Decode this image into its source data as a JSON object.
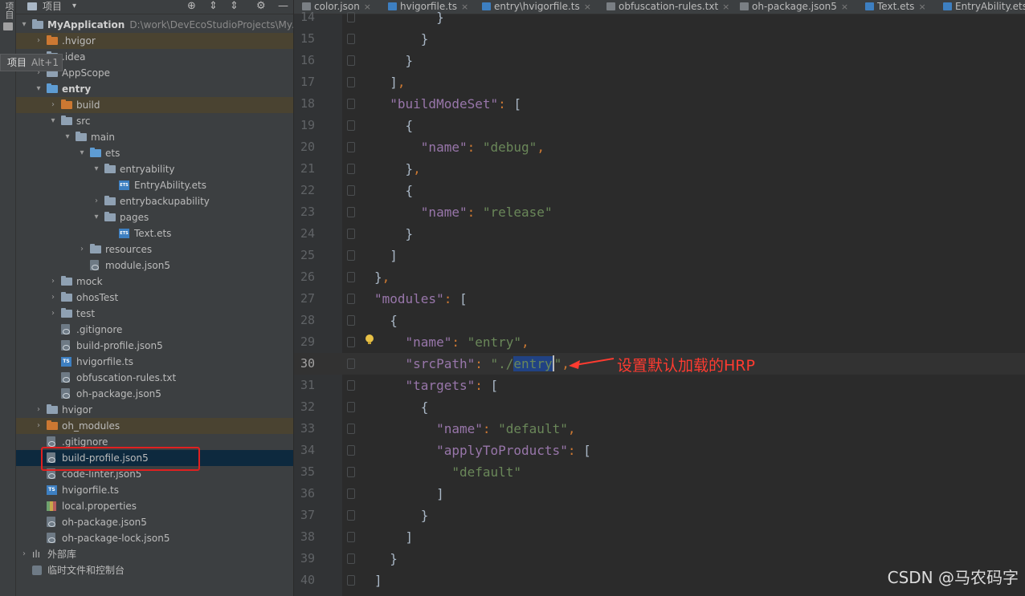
{
  "toolstrip": {
    "label": "项目"
  },
  "panel": {
    "title": "项目",
    "caret": "▾",
    "locate_icon": "⊕",
    "expand_icon": "⇕",
    "collapse_icon": "⇕",
    "settings_icon": "⚙",
    "minimize_icon": "—"
  },
  "tooltip": {
    "text": "项目",
    "shortcut": "Alt+1"
  },
  "tree": [
    {
      "label": "MyApplication",
      "path": "D:\\work\\DevEcoStudioProjects\\MyA",
      "arrow": "▾",
      "icon": "folder"
    },
    {
      "label": ".hvigor",
      "arrow": "›",
      "icon": "folder orange"
    },
    {
      "label": ".idea",
      "arrow": "›",
      "icon": "folder"
    },
    {
      "label": "AppScope",
      "arrow": "›",
      "icon": "folder"
    },
    {
      "label": "entry",
      "arrow": "▾",
      "icon": "folder blue"
    },
    {
      "label": "build",
      "arrow": "›",
      "icon": "folder orange"
    },
    {
      "label": "src",
      "arrow": "▾",
      "icon": "folder"
    },
    {
      "label": "main",
      "arrow": "▾",
      "icon": "folder"
    },
    {
      "label": "ets",
      "arrow": "▾",
      "icon": "folder blue"
    },
    {
      "label": "entryability",
      "arrow": "▾",
      "icon": "folder"
    },
    {
      "label": "EntryAbility.ets",
      "arrow": "",
      "icon": "ets"
    },
    {
      "label": "entrybackupability",
      "arrow": "›",
      "icon": "folder"
    },
    {
      "label": "pages",
      "arrow": "▾",
      "icon": "folder"
    },
    {
      "label": "Text.ets",
      "arrow": "",
      "icon": "ets"
    },
    {
      "label": "resources",
      "arrow": "›",
      "icon": "folder"
    },
    {
      "label": "module.json5",
      "arrow": "",
      "icon": "file"
    },
    {
      "label": "mock",
      "arrow": "›",
      "icon": "folder"
    },
    {
      "label": "ohosTest",
      "arrow": "›",
      "icon": "folder"
    },
    {
      "label": "test",
      "arrow": "›",
      "icon": "folder"
    },
    {
      "label": ".gitignore",
      "arrow": "",
      "icon": "file"
    },
    {
      "label": "build-profile.json5",
      "arrow": "",
      "icon": "file"
    },
    {
      "label": "hvigorfile.ts",
      "arrow": "",
      "icon": "ts"
    },
    {
      "label": "obfuscation-rules.txt",
      "arrow": "",
      "icon": "file"
    },
    {
      "label": "oh-package.json5",
      "arrow": "",
      "icon": "file"
    },
    {
      "label": "hvigor",
      "arrow": "›",
      "icon": "folder"
    },
    {
      "label": "oh_modules",
      "arrow": "›",
      "icon": "folder orange"
    },
    {
      "label": ".gitignore",
      "arrow": "",
      "icon": "file"
    },
    {
      "label": "build-profile.json5",
      "arrow": "",
      "icon": "file"
    },
    {
      "label": "code-linter.json5",
      "arrow": "",
      "icon": "file"
    },
    {
      "label": "hvigorfile.ts",
      "arrow": "",
      "icon": "ts"
    },
    {
      "label": "local.properties",
      "arrow": "",
      "icon": "props"
    },
    {
      "label": "oh-package.json5",
      "arrow": "",
      "icon": "file"
    },
    {
      "label": "oh-package-lock.json5",
      "arrow": "",
      "icon": "file"
    },
    {
      "label": "外部库",
      "arrow": "›",
      "icon": "lib"
    },
    {
      "label": "临时文件和控制台",
      "arrow": "",
      "icon": "cons"
    }
  ],
  "tabs": [
    {
      "label": "color.json",
      "icon": "json"
    },
    {
      "label": "hvigorfile.ts",
      "icon": "ts"
    },
    {
      "label": "entry\\hvigorfile.ts",
      "icon": "ts"
    },
    {
      "label": "obfuscation-rules.txt",
      "icon": "json"
    },
    {
      "label": "oh-package.json5",
      "icon": "json"
    },
    {
      "label": "Text.ets",
      "icon": "ts"
    },
    {
      "label": "EntryAbility.ets",
      "icon": "ts"
    }
  ],
  "tab_close_glyph": "×",
  "code_lines": [
    {
      "n": "14",
      "text": "        }"
    },
    {
      "n": "15",
      "text": "      }"
    },
    {
      "n": "16",
      "text": "    }"
    },
    {
      "n": "17",
      "text": "  ],"
    },
    {
      "n": "18",
      "text": "  \"buildModeSet\": ["
    },
    {
      "n": "19",
      "text": "    {"
    },
    {
      "n": "20",
      "text": "      \"name\": \"debug\","
    },
    {
      "n": "21",
      "text": "    },"
    },
    {
      "n": "22",
      "text": "    {"
    },
    {
      "n": "23",
      "text": "      \"name\": \"release\""
    },
    {
      "n": "24",
      "text": "    }"
    },
    {
      "n": "25",
      "text": "  ]"
    },
    {
      "n": "26",
      "text": "},"
    },
    {
      "n": "27",
      "text": "\"modules\": ["
    },
    {
      "n": "28",
      "text": "  {"
    },
    {
      "n": "29",
      "text": "    \"name\": \"entry\","
    },
    {
      "n": "30",
      "text": "    \"srcPath\": \"./entry\","
    },
    {
      "n": "31",
      "text": "    \"targets\": ["
    },
    {
      "n": "32",
      "text": "      {"
    },
    {
      "n": "33",
      "text": "        \"name\": \"default\","
    },
    {
      "n": "34",
      "text": "        \"applyToProducts\": ["
    },
    {
      "n": "35",
      "text": "          \"default\""
    },
    {
      "n": "36",
      "text": "        ]"
    },
    {
      "n": "37",
      "text": "      }"
    },
    {
      "n": "38",
      "text": "    ]"
    },
    {
      "n": "39",
      "text": "  }"
    },
    {
      "n": "40",
      "text": "]"
    }
  ],
  "annotation": {
    "text": "设置默认加载的HRP",
    "color": "#ff3b30"
  },
  "watermark": "CSDN @马农码字",
  "colors": {
    "key": "#9876aa",
    "string": "#6a8759",
    "punct": "#cc7832",
    "selection": "#214283"
  }
}
